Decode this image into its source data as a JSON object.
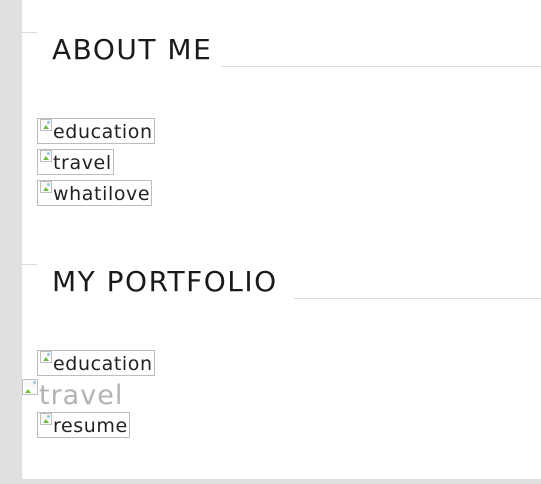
{
  "about": {
    "title": "ABOUT ME",
    "items": [
      {
        "alt": "education"
      },
      {
        "alt": "travel"
      },
      {
        "alt": "whatilove"
      }
    ]
  },
  "portfolio": {
    "title": "MY PORTFOLIO",
    "items": [
      {
        "alt": "education"
      },
      {
        "alt": "travel"
      },
      {
        "alt": "resume"
      }
    ]
  },
  "icons": {
    "image_placeholder": "broken-image-icon"
  },
  "colors": {
    "page_background": "#e0e0e0",
    "panel_background": "#ffffff",
    "title_text": "#1a1a1a",
    "divider": "#dcdcdc"
  }
}
